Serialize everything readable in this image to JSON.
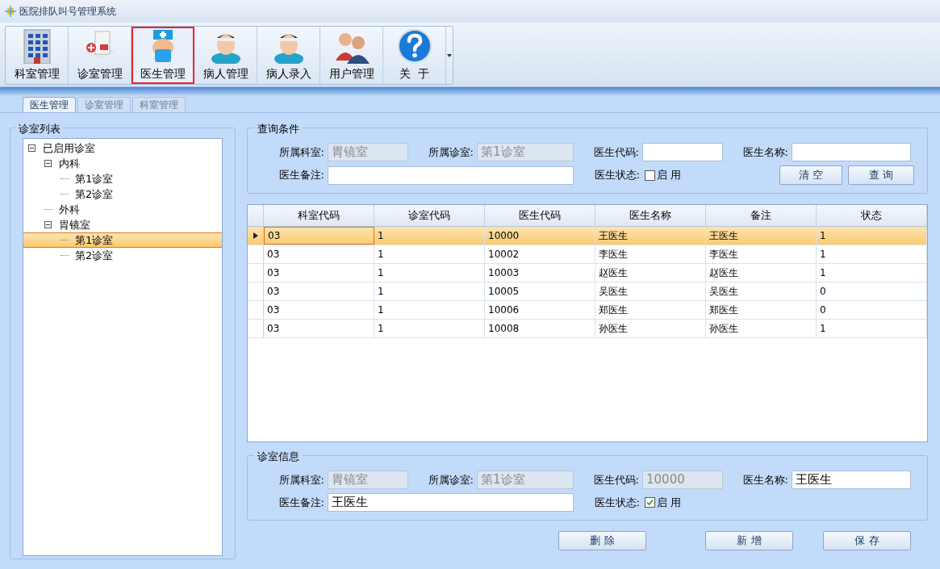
{
  "window": {
    "title": "医院排队叫号管理系统"
  },
  "toolbar": [
    {
      "label": "科室管理",
      "kind": "building",
      "selected": false
    },
    {
      "label": "诊室管理",
      "kind": "clinic",
      "selected": false
    },
    {
      "label": "医生管理",
      "kind": "doctor",
      "selected": true
    },
    {
      "label": "病人管理",
      "kind": "patient",
      "selected": false
    },
    {
      "label": "病人录入",
      "kind": "patient",
      "selected": false
    },
    {
      "label": "用户管理",
      "kind": "users",
      "selected": false
    },
    {
      "label": "关  于",
      "kind": "help",
      "selected": false
    }
  ],
  "tabs": [
    {
      "label": "医生管理",
      "selected": true
    },
    {
      "label": "诊室管理",
      "selected": false
    },
    {
      "label": "科室管理",
      "selected": false
    }
  ],
  "clinic_list": {
    "title": "诊室列表",
    "tree": [
      {
        "label": "已启用诊室",
        "selected": false,
        "children": [
          {
            "label": "内科",
            "selected": false,
            "children": [
              {
                "label": "第1诊室",
                "selected": false
              },
              {
                "label": "第2诊室",
                "selected": false
              }
            ]
          },
          {
            "label": "外科",
            "selected": false
          },
          {
            "label": "胃镜室",
            "selected": false,
            "children": [
              {
                "label": "第1诊室",
                "selected": true
              },
              {
                "label": "第2诊室",
                "selected": false
              }
            ]
          }
        ]
      }
    ]
  },
  "query": {
    "title": "查询条件",
    "fields": [
      {
        "label": "所属科室:",
        "value": "胃镜室",
        "disabled": true
      },
      {
        "label": "所属诊室:",
        "value": "第1诊室",
        "disabled": true
      },
      {
        "label": "医生代码:",
        "disabled": false
      },
      {
        "label": "医生名称:",
        "disabled": false
      },
      {
        "label": "医生备注:",
        "disabled": false
      }
    ],
    "status": {
      "label": "医生状态:",
      "option": "启 用",
      "checked": false
    },
    "buttons": [
      "清 空",
      "查 询"
    ]
  },
  "table": {
    "columns": [
      "科室代码",
      "诊室代码",
      "医生代码",
      "医生名称",
      "备注",
      "状态"
    ],
    "rows": [
      {
        "cells": [
          "03",
          "1",
          "10000",
          "王医生",
          "王医生",
          "1"
        ],
        "selected": true
      },
      {
        "cells": [
          "03",
          "1",
          "10002",
          "李医生",
          "李医生",
          "1"
        ],
        "selected": false
      },
      {
        "cells": [
          "03",
          "1",
          "10003",
          "赵医生",
          "赵医生",
          "1"
        ],
        "selected": false
      },
      {
        "cells": [
          "03",
          "1",
          "10005",
          "吴医生",
          "吴医生",
          "0"
        ],
        "selected": false
      },
      {
        "cells": [
          "03",
          "1",
          "10006",
          "郑医生",
          "郑医生",
          "0"
        ],
        "selected": false
      },
      {
        "cells": [
          "03",
          "1",
          "10008",
          "孙医生",
          "孙医生",
          "1"
        ],
        "selected": false
      }
    ]
  },
  "info": {
    "title": "诊室信息",
    "fields": [
      {
        "label": "所属科室:",
        "value": "胃镜室",
        "disabled": true
      },
      {
        "label": "所属诊室:",
        "value": "第1诊室",
        "disabled": true
      },
      {
        "label": "医生代码:",
        "value": "10000",
        "disabled": true
      },
      {
        "label": "医生名称:",
        "value": "王医生",
        "disabled": false
      },
      {
        "label": "医生备注:",
        "value": "王医生",
        "disabled": false
      }
    ],
    "status": {
      "label": "医生状态:",
      "option": "启 用",
      "checked": true
    }
  },
  "actions": [
    "删 除",
    "新 增",
    "保 存"
  ]
}
